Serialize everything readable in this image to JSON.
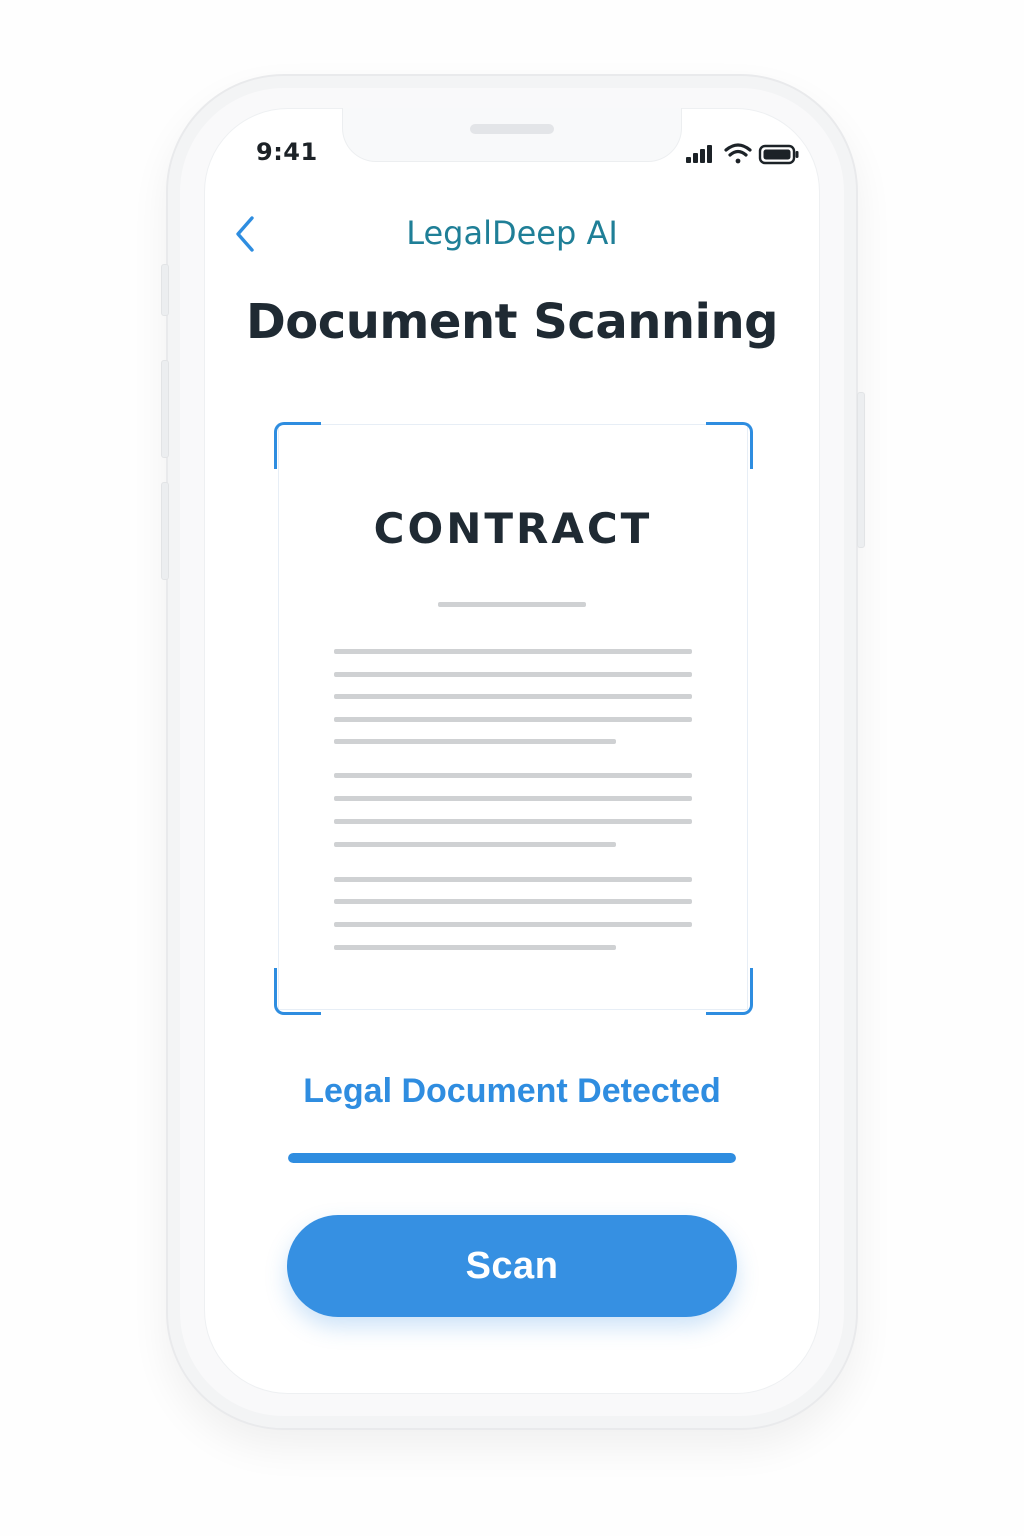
{
  "status_bar": {
    "time": "9:41",
    "icons": [
      "cellular-signal-icon",
      "wifi-icon",
      "battery-icon"
    ]
  },
  "nav": {
    "back_icon": "chevron-left-icon",
    "title": "LegalDeep AI"
  },
  "page_title": "Document Scanning",
  "document": {
    "heading": "CONTRACT"
  },
  "scan_status": {
    "text": "Legal Document Detected",
    "progress": 1.0
  },
  "actions": {
    "scan_label": "Scan"
  },
  "colors": {
    "accent": "#2f8de0",
    "nav_title": "#1f7f97",
    "text_dark": "#1f2a33",
    "button": "#3690e2"
  }
}
